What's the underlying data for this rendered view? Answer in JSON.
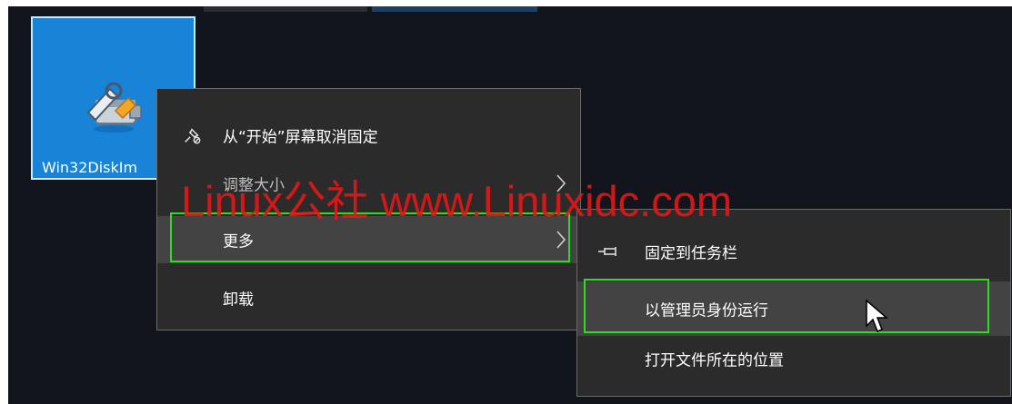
{
  "desktop": {
    "tile": {
      "label": "Win32DiskIm",
      "icon": "usb-disk-wrench-icon"
    }
  },
  "context_menu": {
    "items": [
      {
        "label": "从“开始”屏幕取消固定",
        "icon": "unpin-icon"
      },
      {
        "label": "调整大小",
        "submenu": true
      },
      {
        "label": "更多",
        "submenu": true,
        "highlighted": true
      },
      {
        "label": "卸载"
      }
    ]
  },
  "submenu": {
    "items": [
      {
        "label": "固定到任务栏",
        "icon": "pin-icon"
      },
      {
        "label": "以管理员身份运行",
        "highlighted": true
      },
      {
        "label": "打开文件所在的位置"
      }
    ]
  },
  "watermark": {
    "text": "Linux公社 www.Linuxidc.com"
  },
  "colors": {
    "accent": "#1883d7",
    "outline": "#2dde1e",
    "watermark": "#e61717",
    "menu_bg": "#2b2b2b"
  }
}
